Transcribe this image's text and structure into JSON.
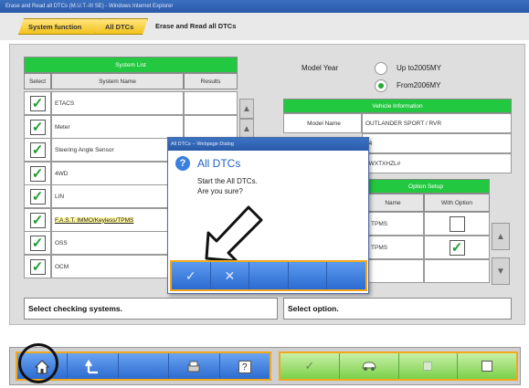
{
  "window": {
    "title": "Erase and Read all DTCs (M.U.T.-III SE) - Windows Internet Explorer"
  },
  "tabs": {
    "tab1": "System function",
    "tab2": "All DTCs",
    "current": "Erase and Read all DTCs"
  },
  "system_list": {
    "header": "System List",
    "columns": {
      "select": "Select",
      "system_name": "System Name",
      "results": "Results"
    },
    "rows": [
      {
        "name": "ETACS",
        "checked": true
      },
      {
        "name": "Meter",
        "checked": true
      },
      {
        "name": "Steering Angle Sensor",
        "checked": true
      },
      {
        "name": "4WD",
        "checked": true
      },
      {
        "name": "LIN",
        "checked": true
      },
      {
        "name": "F.A.S.T. IMMO/Keyless/TPMS",
        "checked": true
      },
      {
        "name": "OSS",
        "checked": true
      },
      {
        "name": "OCM",
        "checked": true
      }
    ],
    "status": "Select checking systems."
  },
  "model_year": {
    "label": "Model Year",
    "options": [
      "Up to2005MY",
      "From2006MY"
    ],
    "selected": "From2006MY"
  },
  "vehicle_info": {
    "header": "Vehicle Information",
    "model_label": "Model Name",
    "model_value": "OUTLANDER SPORT / RVR",
    "row2_value": "14",
    "row3_value": "2WXTXHZL#"
  },
  "option_setup": {
    "header": "Option Setup",
    "columns": {
      "name": "Name",
      "with_option": "With Option"
    },
    "rows": [
      {
        "name": "& TPMS",
        "checked": false
      },
      {
        "name": "& TPMS",
        "checked": true
      }
    ],
    "status": "Select option."
  },
  "dialog": {
    "title": "All DTCs -- Webpage Dialog",
    "heading": "All DTCs",
    "message_line1": "Start the All DTCs.",
    "message_line2": "Are you sure?",
    "ok_glyph": "✓",
    "cancel_glyph": "✕"
  },
  "toolbar": {
    "home_icon": "home-icon",
    "back_icon": "return-arrow-icon",
    "print_icon": "printer-icon",
    "help_label": "?"
  },
  "colors": {
    "accent_blue": "#2c6bd0",
    "header_green": "#22c840",
    "orange_border": "#f2a81c",
    "tab_yellow": "#f2c218"
  }
}
